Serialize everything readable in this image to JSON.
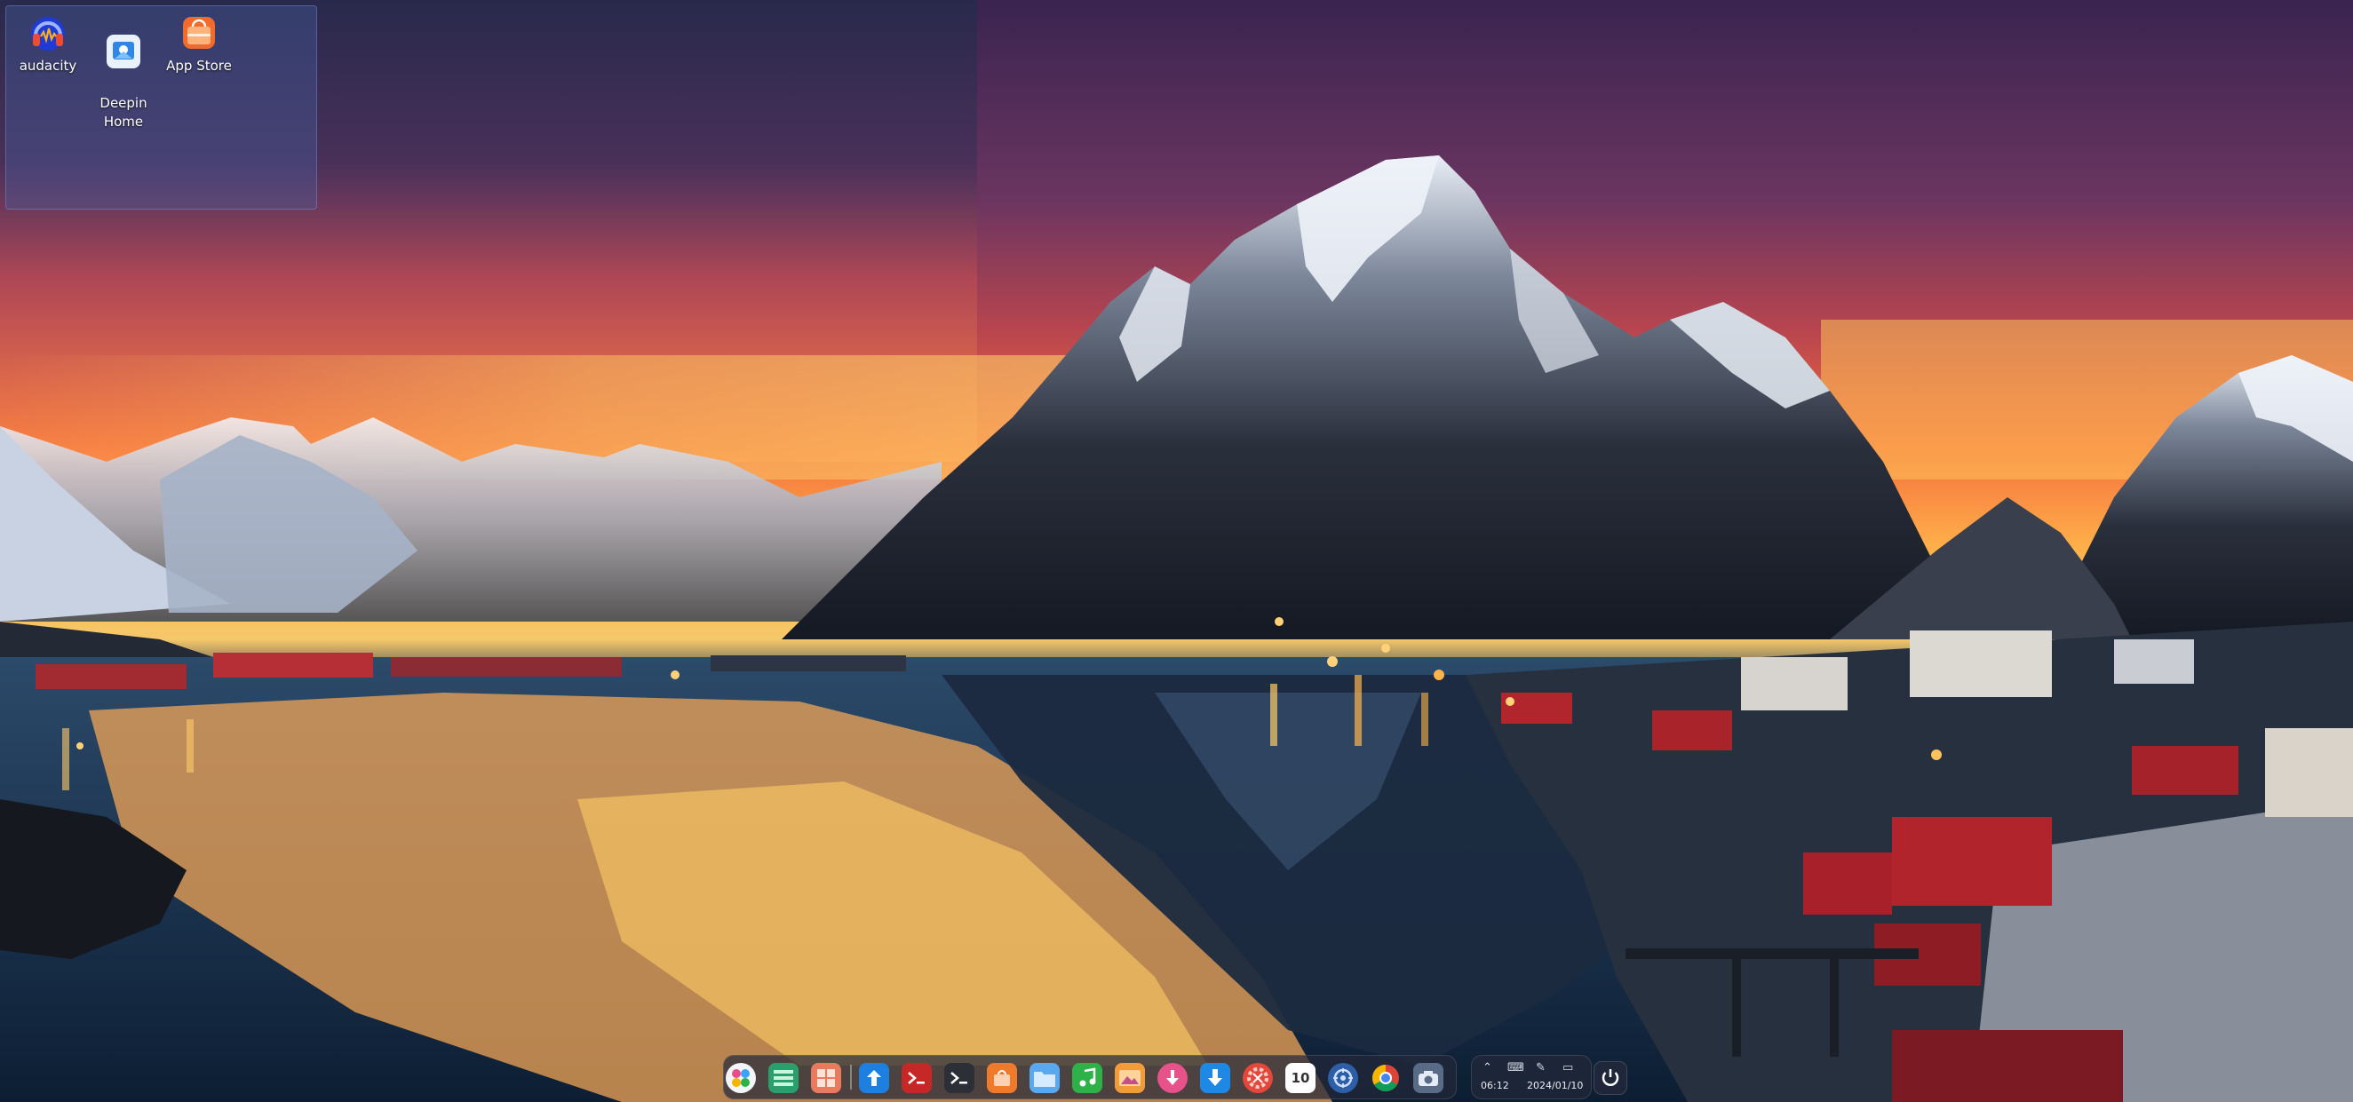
{
  "desktop": {
    "icons": [
      {
        "label": "audacity",
        "icon": "audacity-icon"
      },
      {
        "label": "Deepin\nHome",
        "icon": "deepin-home-icon"
      },
      {
        "label": "App Store",
        "icon": "app-store-icon"
      }
    ]
  },
  "dock": {
    "apps": [
      {
        "name": "launcher",
        "icon": "launcher-icon",
        "color": "#e94c8a"
      },
      {
        "name": "multitasking",
        "icon": "multitask-icon",
        "color": "#2b9f6b"
      },
      {
        "name": "show-desktop",
        "icon": "show-desktop-icon",
        "color": "#e87a5d"
      },
      {
        "name": "file-manager",
        "icon": "file-manager-icon",
        "color": "#1d7fe0"
      },
      {
        "name": "terminal-red",
        "icon": "terminal-red-icon",
        "color": "#c62828"
      },
      {
        "name": "terminal",
        "icon": "terminal-icon",
        "color": "#2d2f36"
      },
      {
        "name": "app-store",
        "icon": "app-store-icon",
        "color": "#f07a2b"
      },
      {
        "name": "folder",
        "icon": "folder-icon",
        "color": "#5aa8f0"
      },
      {
        "name": "music",
        "icon": "music-icon",
        "color": "#2fb14a"
      },
      {
        "name": "photos",
        "icon": "photos-icon",
        "color": "#f29b39"
      },
      {
        "name": "download",
        "icon": "downloader-icon",
        "color": "#e8528b"
      },
      {
        "name": "update",
        "icon": "update-icon",
        "color": "#1e88e5"
      },
      {
        "name": "settings",
        "icon": "settings-icon",
        "color": "#e5473a"
      },
      {
        "name": "calendar",
        "icon": "calendar-icon",
        "color": "#ffffff",
        "text": "10"
      },
      {
        "name": "control-center",
        "icon": "control-center-icon",
        "color": "#2d5ea8"
      },
      {
        "name": "chrome",
        "icon": "chrome-icon",
        "color": "#f2c335"
      },
      {
        "name": "screenshot",
        "icon": "camera-icon",
        "color": "#5a6b85"
      }
    ]
  },
  "tray": {
    "time": "06:12",
    "date": "2024/01/10",
    "icons": [
      "chevron-up-icon",
      "keyboard-icon",
      "pen-icon",
      "battery-icon"
    ]
  },
  "colors": {
    "accent": "#1d7fe0",
    "dock_bg": "#23283a"
  }
}
